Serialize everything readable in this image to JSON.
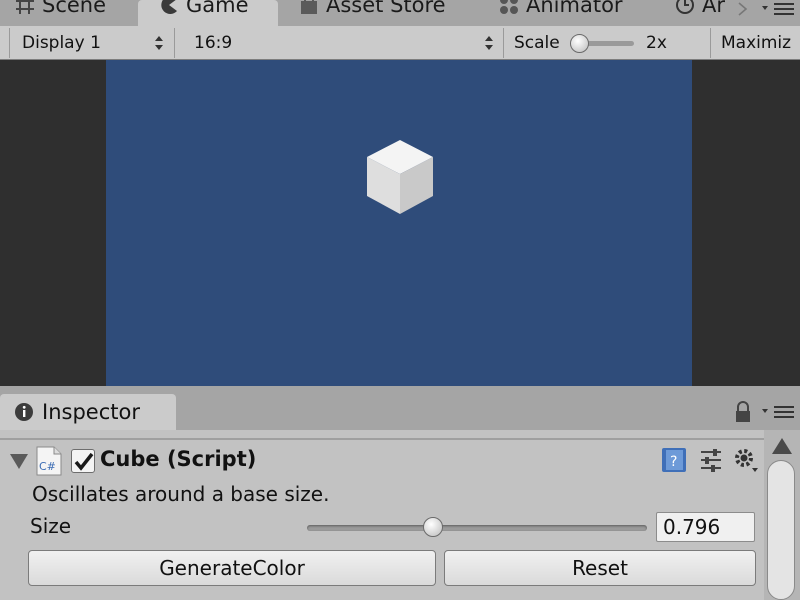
{
  "tabs": [
    {
      "label": "Scene",
      "icon": "grid-icon"
    },
    {
      "label": "Game",
      "icon": "pacman-icon",
      "active": true
    },
    {
      "label": "Asset Store",
      "icon": "store-bag-icon"
    },
    {
      "label": "Animator",
      "icon": "animator-icon"
    },
    {
      "label": "Ar",
      "icon": "clock-icon"
    }
  ],
  "toolbar": {
    "display": "Display 1",
    "aspect": "16:9",
    "scale_label": "Scale",
    "scale_value": "2x",
    "scale_fraction": 0.05,
    "maximize_label": "Maximiz"
  },
  "game": {
    "background_color": "#2f4c7a",
    "letterbox_color": "#2f2f2f"
  },
  "inspector": {
    "tab_label": "Inspector",
    "component": {
      "title": "Cube (Script)",
      "enabled": true,
      "icon": "csharp-script-icon",
      "description": "Oscillates around a base size.",
      "size_label": "Size",
      "size_value": "0.796",
      "size_fraction": 0.37,
      "buttons": {
        "generate": "GenerateColor",
        "reset": "Reset"
      }
    }
  }
}
